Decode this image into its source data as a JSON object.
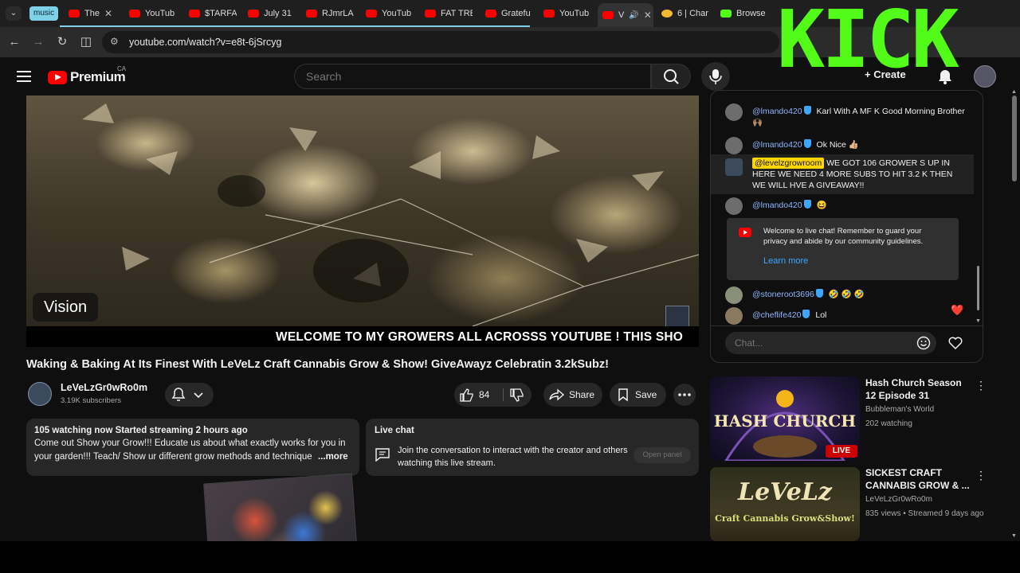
{
  "browser": {
    "tab_group_label": "music",
    "tabs": [
      {
        "title": "The",
        "fav_color": "#ff0000"
      },
      {
        "title": "YouTub",
        "fav_color": "#ff0000"
      },
      {
        "title": "$TARFA",
        "fav_color": "#ff0000"
      },
      {
        "title": "July 31",
        "fav_color": "#ff0000"
      },
      {
        "title": "RJmrLA",
        "fav_color": "#ff0000"
      },
      {
        "title": "YouTub",
        "fav_color": "#ff0000"
      },
      {
        "title": "FAT TRE",
        "fav_color": "#ff0000"
      },
      {
        "title": "Gratefu",
        "fav_color": "#ff0000"
      },
      {
        "title": "YouTub",
        "fav_color": "#ff0000"
      },
      {
        "title": "V",
        "fav_color": "#ff0000"
      },
      {
        "title": "6 | Char",
        "fav_color": "#f3ba2f"
      },
      {
        "title": "Browse",
        "fav_color": "#53fc18"
      }
    ],
    "url": "youtube.com/watch?v=e8t-6jSrcyg"
  },
  "overlay": {
    "logo_text": "KICK",
    "color": "#53fc18"
  },
  "header": {
    "logo_word": "Premium",
    "country": "CA",
    "search_placeholder": "Search",
    "create_label": "Create"
  },
  "video": {
    "tag": "Vision",
    "ticker": "WELCOME TO MY GROWERS ALL ACROSSS YOUTUBE ! THIS SHO",
    "title": "Waking & Baking At Its Finest With LeVeLz Craft Cannabis Grow & Show! GiveAwayz Celebratin 3.2kSubz!"
  },
  "channel": {
    "name": "LeVeLzGr0wRo0m",
    "subscribers": "3.19K subscribers"
  },
  "actions": {
    "likes": "84",
    "share": "Share",
    "save": "Save"
  },
  "description": {
    "stats": "105 watching now  Started streaming 2 hours ago",
    "line1": "Come out Show your Grow!!! Educate us about what exactly works for you in",
    "line2": "your garden!!! Teach/ Show ur different grow methods and technique",
    "more": "...more"
  },
  "live_chat_card": {
    "title": "Live chat",
    "text": "Join the conversation to interact with the creator and others watching this live stream.",
    "button": "Open panel"
  },
  "chat": {
    "messages": [
      {
        "author": "@lmando420",
        "text": "Karl With A MF K Good Morning Brother 🙌🏽",
        "owner": false
      },
      {
        "author": "@lmando420",
        "text": "Ok Nice 👍🏼",
        "owner": false
      },
      {
        "author": "@levelzgrowroom",
        "text": "WE GOT 106 GROWER S UP IN HERE WE NEED 4 MORE SUBS TO HIT 3.2 K THEN WE WILL HVE A GIVEAWAY!!",
        "owner": true
      },
      {
        "author": "@lmando420",
        "text": "😆",
        "owner": false
      },
      {
        "author": "@stoneroot3696",
        "text": "🤣 🤣 🤣",
        "owner": false
      },
      {
        "author": "@cheflife420",
        "text": "Lol",
        "owner": false
      }
    ],
    "welcome_text": "Welcome to live chat! Remember to guard your privacy and abide by our community guidelines.",
    "learn_more": "Learn more",
    "input_placeholder": "Chat...",
    "reaction": "❤️"
  },
  "recommendations": [
    {
      "title": "Hash Church Season 12 Episode 31",
      "channel": "Bubbleman's World",
      "meta": "202 watching",
      "badge": "LIVE",
      "thumb_text": "HASH CHURCH"
    },
    {
      "title": "SICKEST CRAFT CANNABIS GROW & ...",
      "channel": "LeVeLzGr0wRo0m",
      "meta": "835 views • Streamed 9 days ago",
      "thumb_text": "LeVeLz",
      "thumb_subtext": "Craft Cannabis Grow&Show!"
    }
  ]
}
